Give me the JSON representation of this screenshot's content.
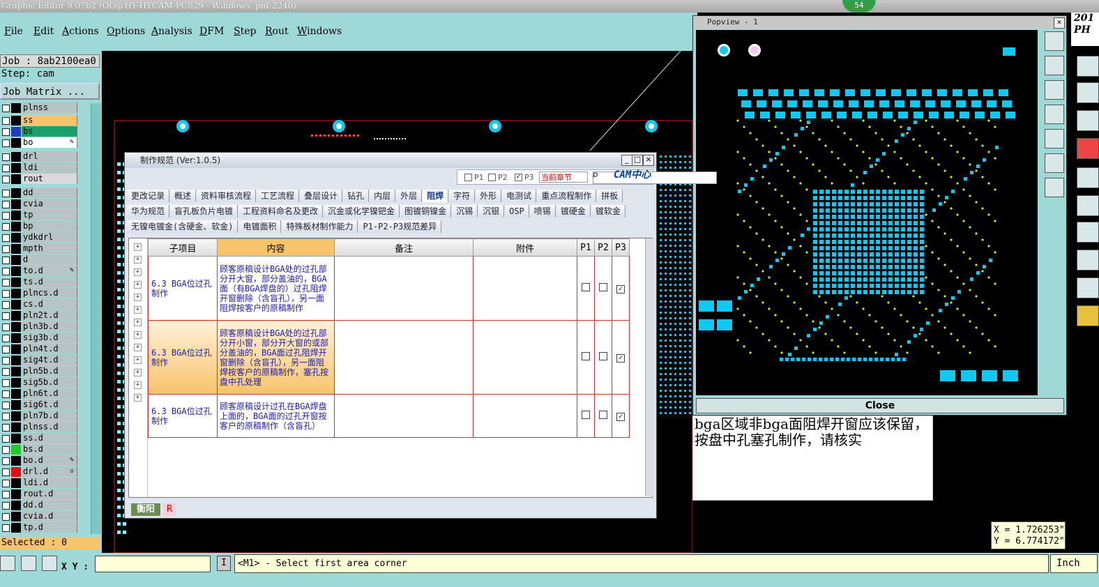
{
  "window": {
    "title": "Graphic Editor 9.07b2 (OO@HY-HYCAM-PC029 - Windows, pid:2240)",
    "badge": "54"
  },
  "menu": [
    "File",
    "Edit",
    "Actions",
    "Options",
    "Analysis",
    "DFM",
    "Step",
    "Rout",
    "Windows"
  ],
  "left_panel": {
    "job": "Job : 8ab2100ea0",
    "step": "Step: cam",
    "job_matrix": "Job Matrix ...",
    "layers": [
      {
        "name": "plnss",
        "color": "#000000"
      },
      {
        "name": "ss",
        "color": "#000000",
        "bg": "#f7c36b"
      },
      {
        "name": "bs",
        "color": "#1f3fbf",
        "bg": "#1aa06a"
      },
      {
        "name": "bo",
        "color": "#000000",
        "bg": "#ffffff",
        "mark": "✎"
      },
      {
        "name": "drl",
        "color": "#000000"
      },
      {
        "name": "ldi",
        "color": "#000000"
      },
      {
        "name": "rout",
        "color": "#000000",
        "bg": "#d9dada"
      },
      {
        "name": "dd",
        "color": "#000000"
      },
      {
        "name": "cvia",
        "color": "#000000"
      },
      {
        "name": "tp",
        "color": "#000000"
      },
      {
        "name": "bp",
        "color": "#000000"
      },
      {
        "name": "ydkdrl",
        "color": "#000000"
      },
      {
        "name": "mpth",
        "color": "#000000"
      },
      {
        "name": "d",
        "color": "#000000"
      },
      {
        "name": "to.d",
        "color": "#000000",
        "mark": "✎"
      },
      {
        "name": "ts.d",
        "color": "#000000"
      },
      {
        "name": "plncs.d",
        "color": "#000000"
      },
      {
        "name": "cs.d",
        "color": "#000000"
      },
      {
        "name": "pln2t.d",
        "color": "#000000"
      },
      {
        "name": "pln3b.d",
        "color": "#000000"
      },
      {
        "name": "sig3b.d",
        "color": "#000000"
      },
      {
        "name": "pln4t.d",
        "color": "#000000"
      },
      {
        "name": "sig4t.d",
        "color": "#000000"
      },
      {
        "name": "pln5b.d",
        "color": "#000000"
      },
      {
        "name": "sig5b.d",
        "color": "#000000"
      },
      {
        "name": "pln6t.d",
        "color": "#000000"
      },
      {
        "name": "sig6t.d",
        "color": "#000000"
      },
      {
        "name": "pln7b.d",
        "color": "#000000"
      },
      {
        "name": "plnss.d",
        "color": "#000000"
      },
      {
        "name": "ss.d",
        "color": "#000000"
      },
      {
        "name": "bs.d",
        "color": "#22cc22"
      },
      {
        "name": "bo.d",
        "color": "#000000",
        "mark": "✎"
      },
      {
        "name": "drl.d",
        "color": "#e01010",
        "mark": "▫"
      },
      {
        "name": "ldi.d",
        "color": "#000000"
      },
      {
        "name": "rout.d",
        "color": "#000000"
      },
      {
        "name": "dd.d",
        "color": "#000000"
      },
      {
        "name": "cvia.d",
        "color": "#000000"
      },
      {
        "name": "tp.d",
        "color": "#000000"
      }
    ],
    "selected": "Selected : 0"
  },
  "status": {
    "xy_label": "X Y :",
    "xy_value": "",
    "xy_button": "I",
    "prompt": "<M1> - Select first area corner",
    "units": "Inch"
  },
  "coords": {
    "x": "X = 1.726253\"",
    "y": "Y = 6.774172\""
  },
  "right_top": {
    "line1": "201",
    "line2": "PH"
  },
  "popview": {
    "title": "Popview - 1",
    "close_label": "Close"
  },
  "note": "bga区域非bga面阻焊开窗应该保留，按盘中孔塞孔制作，请核实",
  "dialog": {
    "title": "制作规范 (Ver:1.0.5)",
    "filters": {
      "p1": "P1",
      "p2": "P2",
      "p3": "P3",
      "chapter": "当前章节"
    },
    "cam_logo": "CAM中心",
    "tabs_row1": [
      "更改记录",
      "概述",
      "资料审核流程",
      "工艺流程",
      "叠层设计",
      "钻孔",
      "内层",
      "外层",
      "阻焊",
      "字符",
      "外形",
      "电测试",
      "重点流程制作",
      "拼板"
    ],
    "active_tab": "阻焊",
    "tabs_row2": [
      "华为规范",
      "盲孔板负片电镀",
      "工程资料命名及更改",
      "沉金或化学镍钯金",
      "图镀铜镍金",
      "沉锡",
      "沉银",
      "OSP",
      "喷锡",
      "镀硬金",
      "镀软金"
    ],
    "tabs_row3": [
      "无镍电镀金(含硬金、软金)",
      "电镀面积",
      "特殊板材制作能力",
      "P1-P2-P3规范差异"
    ],
    "columns": [
      "子项目",
      "内容",
      "备注",
      "附件",
      "P1",
      "P2",
      "P3"
    ],
    "rows": [
      {
        "item": "6.3 BGA位过孔制作",
        "content": "顾客原稿设计BGA处的过孔部分开大窗，部分盖油的，BGA面（有BGA焊盘的）过孔阻焊开窗删除（含盲孔），另一面阻焊按客户的原稿制作",
        "note": "",
        "attach": "",
        "p1": "",
        "p2": "",
        "p3": "✓"
      },
      {
        "item": "6.3 BGA位过孔制作",
        "content": "顾客原稿设计BGA处的过孔部分开小窗，部分开大窗的或部分盖油的，BGA面过孔阻焊开窗删除（含盲孔），另一面阻焊按客户的原稿制作，塞孔按盘中孔处理",
        "note": "",
        "attach": "",
        "p1": "",
        "p2": "",
        "p3": "✓"
      },
      {
        "item": "6.3 BGA位过孔制作",
        "content": "顾客原稿设计过孔在BGA焊盘上面的，BGA面的过孔开窗按客户的原稿制作（含盲孔）",
        "note": "",
        "attach": "",
        "p1": "",
        "p2": "",
        "p3": "✓"
      }
    ],
    "footer_btn1": "衡阳",
    "footer_btn2": "R"
  },
  "colors": {
    "panel": "#9ed9d8",
    "highlight": "#f7c36b",
    "pad": "#12c8f0",
    "via": "#c8f018",
    "outline": "#d02020"
  }
}
